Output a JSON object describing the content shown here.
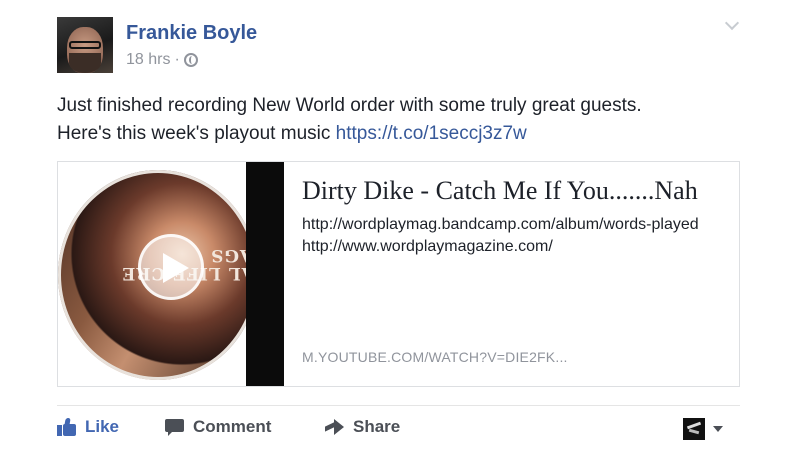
{
  "post": {
    "author": "Frankie Boyle",
    "time": "18 hrs",
    "separator": "·",
    "privacy_icon": "globe-icon",
    "text_line1": "Just finished recording New World order with some truly great guests.",
    "text_line2_prefix": "Here's this week's playout music ",
    "link": "https://t.co/1seccj3z7w"
  },
  "preview": {
    "title": "Dirty Dike - Catch Me If You.......Nah",
    "description": "http://wordplaymag.bandcamp.com/album/words-played http://www.wordplaymagazine.com/",
    "domain": "M.YOUTUBE.COM/WATCH?V=DIE2FK...",
    "thumb_text": "REAL LIFE CRE DRAGS"
  },
  "actions": {
    "like": "Like",
    "comment": "Comment",
    "share": "Share"
  },
  "colors": {
    "link_blue": "#365899",
    "like_blue": "#4267b2",
    "meta_gray": "#90949c"
  }
}
